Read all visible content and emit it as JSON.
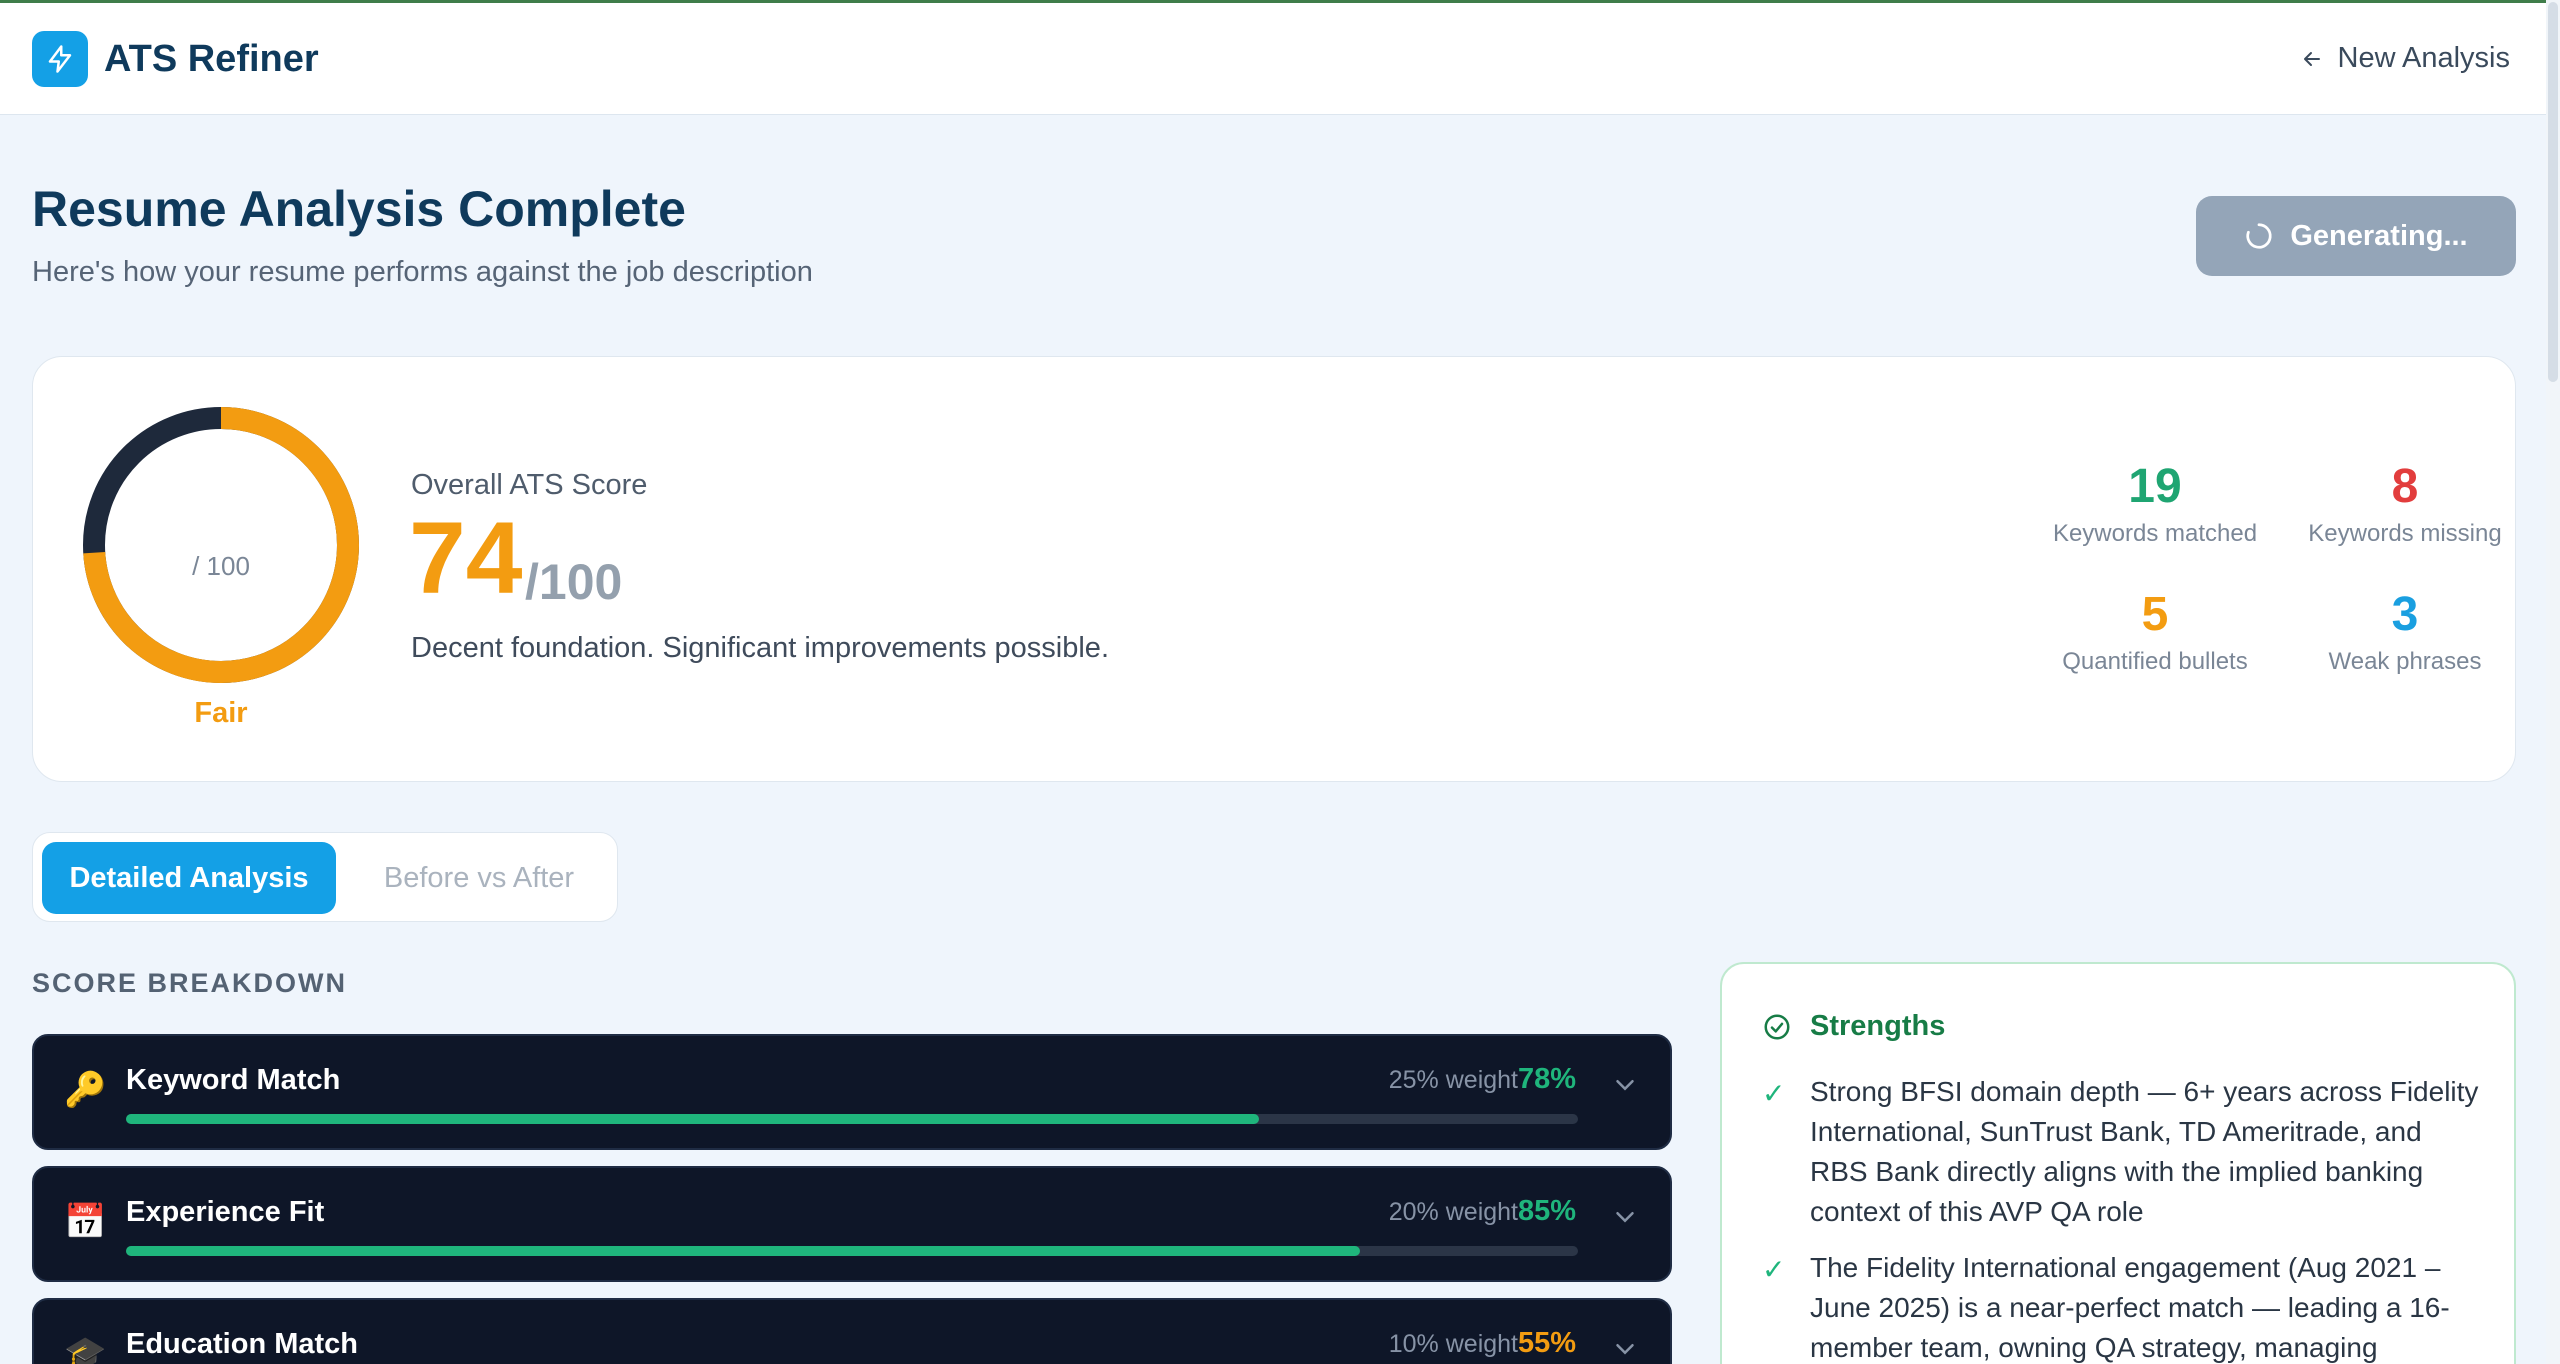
{
  "header": {
    "brand": "ATS Refiner",
    "new_analysis": "New Analysis"
  },
  "page": {
    "title": "Resume Analysis Complete",
    "subtitle": "Here's how your resume performs against the job description",
    "generate_button": "Generating..."
  },
  "score_card": {
    "ring_label": "/ 100",
    "rating": "Fair",
    "overall_label": "Overall ATS Score",
    "score": "74",
    "score_denominator": "/100",
    "score_fraction": 0.74,
    "verdict": "Decent foundation. Significant improvements possible.",
    "stats": [
      {
        "value": "19",
        "label": "Keywords matched",
        "color": "#1fa572"
      },
      {
        "value": "8",
        "label": "Keywords missing",
        "color": "#e23d3d"
      },
      {
        "value": "5",
        "label": "Quantified bullets",
        "color": "#f39c11"
      },
      {
        "value": "3",
        "label": "Weak phrases",
        "color": "#1a9fe0"
      }
    ]
  },
  "tabs": {
    "active": "Detailed Analysis",
    "inactive": "Before vs After"
  },
  "breakdown": {
    "heading": "SCORE BREAKDOWN",
    "rows": [
      {
        "icon": "key-icon",
        "glyph": "🔑",
        "name": "Keyword Match",
        "weight": "25% weight",
        "pct": "78%",
        "value": 0.78,
        "color": "#1fb57c"
      },
      {
        "icon": "calendar-icon",
        "glyph": "📅",
        "name": "Experience Fit",
        "weight": "20% weight",
        "pct": "85%",
        "value": 0.85,
        "color": "#1fb57c"
      },
      {
        "icon": "graduation-cap-icon",
        "glyph": "🎓",
        "name": "Education Match",
        "weight": "10% weight",
        "pct": "55%",
        "value": 0.55,
        "color": "#f39c11"
      }
    ]
  },
  "strengths": {
    "heading": "Strengths",
    "items": [
      "Strong BFSI domain depth — 6+ years across Fidelity International, SunTrust Bank, TD Ameritrade, and RBS Bank directly aligns with the implied banking context of this AVP QA role",
      "The Fidelity International engagement (Aug 2021 – June 2025) is a near-perfect match — leading a 16-member team, owning QA strategy, managing"
    ]
  }
}
